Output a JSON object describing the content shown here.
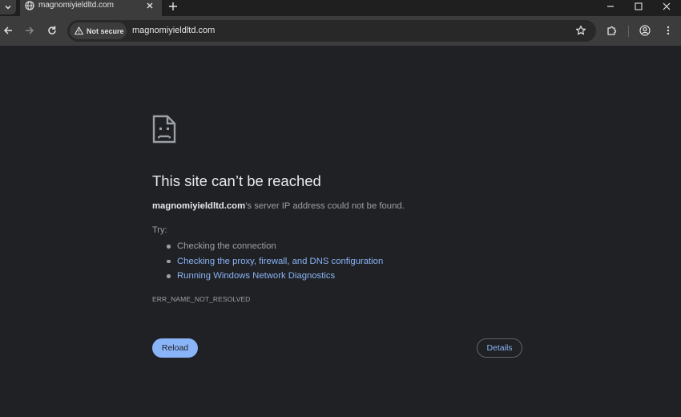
{
  "browser": {
    "tab": {
      "title": "magnomiyieldltd.com",
      "favicon": "globe-icon"
    },
    "omnibox": {
      "security_label": "Not secure",
      "security_icon": "warning-triangle-icon",
      "url": "magnomiyieldltd.com"
    }
  },
  "error_page": {
    "icon": "sad-page-icon",
    "heading": "This site can’t be reached",
    "summary_host": "magnomiyieldltd.com",
    "summary_rest": "’s server IP address could not be found.",
    "try_label": "Try:",
    "suggestions": [
      {
        "text": "Checking the connection",
        "is_link": false
      },
      {
        "text": "Checking the proxy, firewall, and DNS configuration",
        "is_link": true
      },
      {
        "text": "Running Windows Network Diagnostics",
        "is_link": true
      }
    ],
    "error_code": "ERR_NAME_NOT_RESOLVED",
    "reload_label": "Reload",
    "details_label": "Details"
  },
  "colors": {
    "page_bg": "#202124",
    "accent": "#8ab4f8",
    "heading": "#e8eaed",
    "text": "#9aa0a6"
  }
}
